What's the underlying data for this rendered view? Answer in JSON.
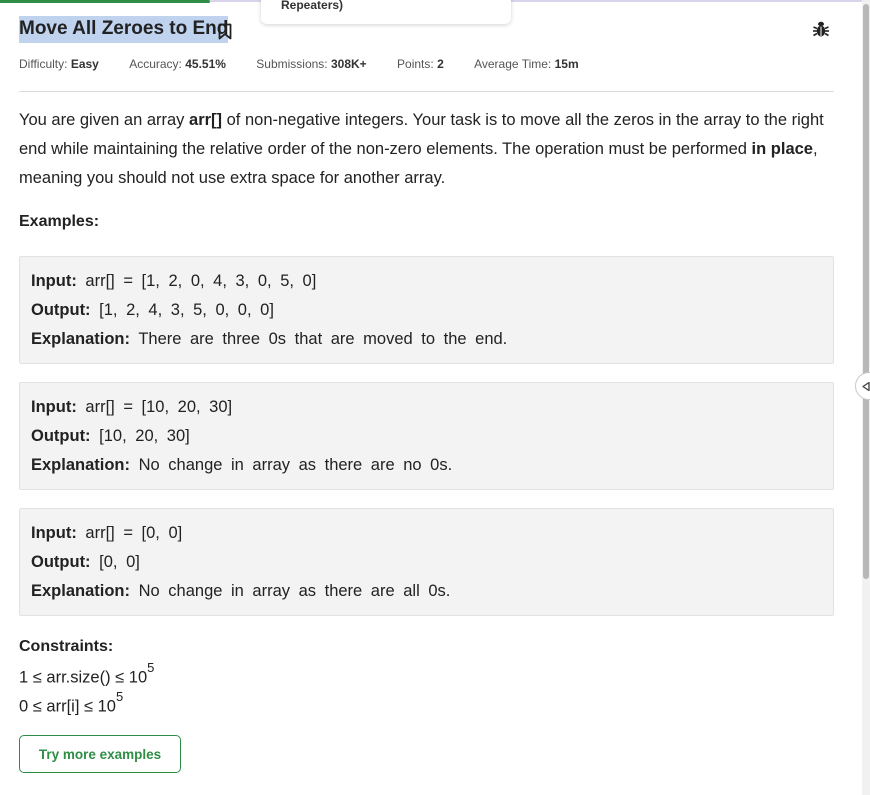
{
  "tooltip": {
    "text": "Repeaters)"
  },
  "problem": {
    "title": "Move All Zeroes to End",
    "meta": {
      "difficulty_label": "Difficulty:",
      "difficulty": "Easy",
      "accuracy_label": "Accuracy:",
      "accuracy": "45.51%",
      "submissions_label": "Submissions:",
      "submissions": "308K+",
      "points_label": "Points:",
      "points": "2",
      "avg_time_label": "Average Time:",
      "avg_time": "15m"
    },
    "description": {
      "part1": "You are given an array ",
      "code": "arr[]",
      "part2": " of non-negative integers. Your task is to move all the zeros in the array to the right end while maintaining the relative order of the non-zero elements. The operation must be performed ",
      "emph": "in place",
      "part3": ", meaning you should not use extra space for another array."
    },
    "examples_heading": "Examples:",
    "input_label": "Input:",
    "output_label": "Output:",
    "explanation_label": "Explanation:",
    "examples": [
      {
        "input": "arr[] = [1, 2, 0, 4, 3, 0, 5, 0]",
        "output": "[1, 2, 4, 3, 5, 0, 0, 0]",
        "explanation": "There are three 0s that are moved to the end."
      },
      {
        "input": "arr[] = [10, 20, 30]",
        "output": "[10, 20, 30]",
        "explanation": "No change in array as there are no 0s."
      },
      {
        "input": "arr[] = [0, 0]",
        "output": "[0, 0]",
        "explanation": "No change in array as there are all 0s."
      }
    ],
    "constraints_heading": "Constraints:",
    "constraints": [
      {
        "text": "1 ≤ arr.size() ≤ 10",
        "exp": "5"
      },
      {
        "text": "0 ≤ arr[i] ≤ 10",
        "exp": "5"
      }
    ],
    "try_button": "Try more examples"
  },
  "icons": {
    "bookmark": "bookmark-icon",
    "report": "bug-icon",
    "panel_toggle": "chevron-left-icon"
  },
  "colors": {
    "accent": "#2f8d46",
    "title_highlight": "#bfd3ef",
    "example_bg": "#f3f3f3"
  }
}
